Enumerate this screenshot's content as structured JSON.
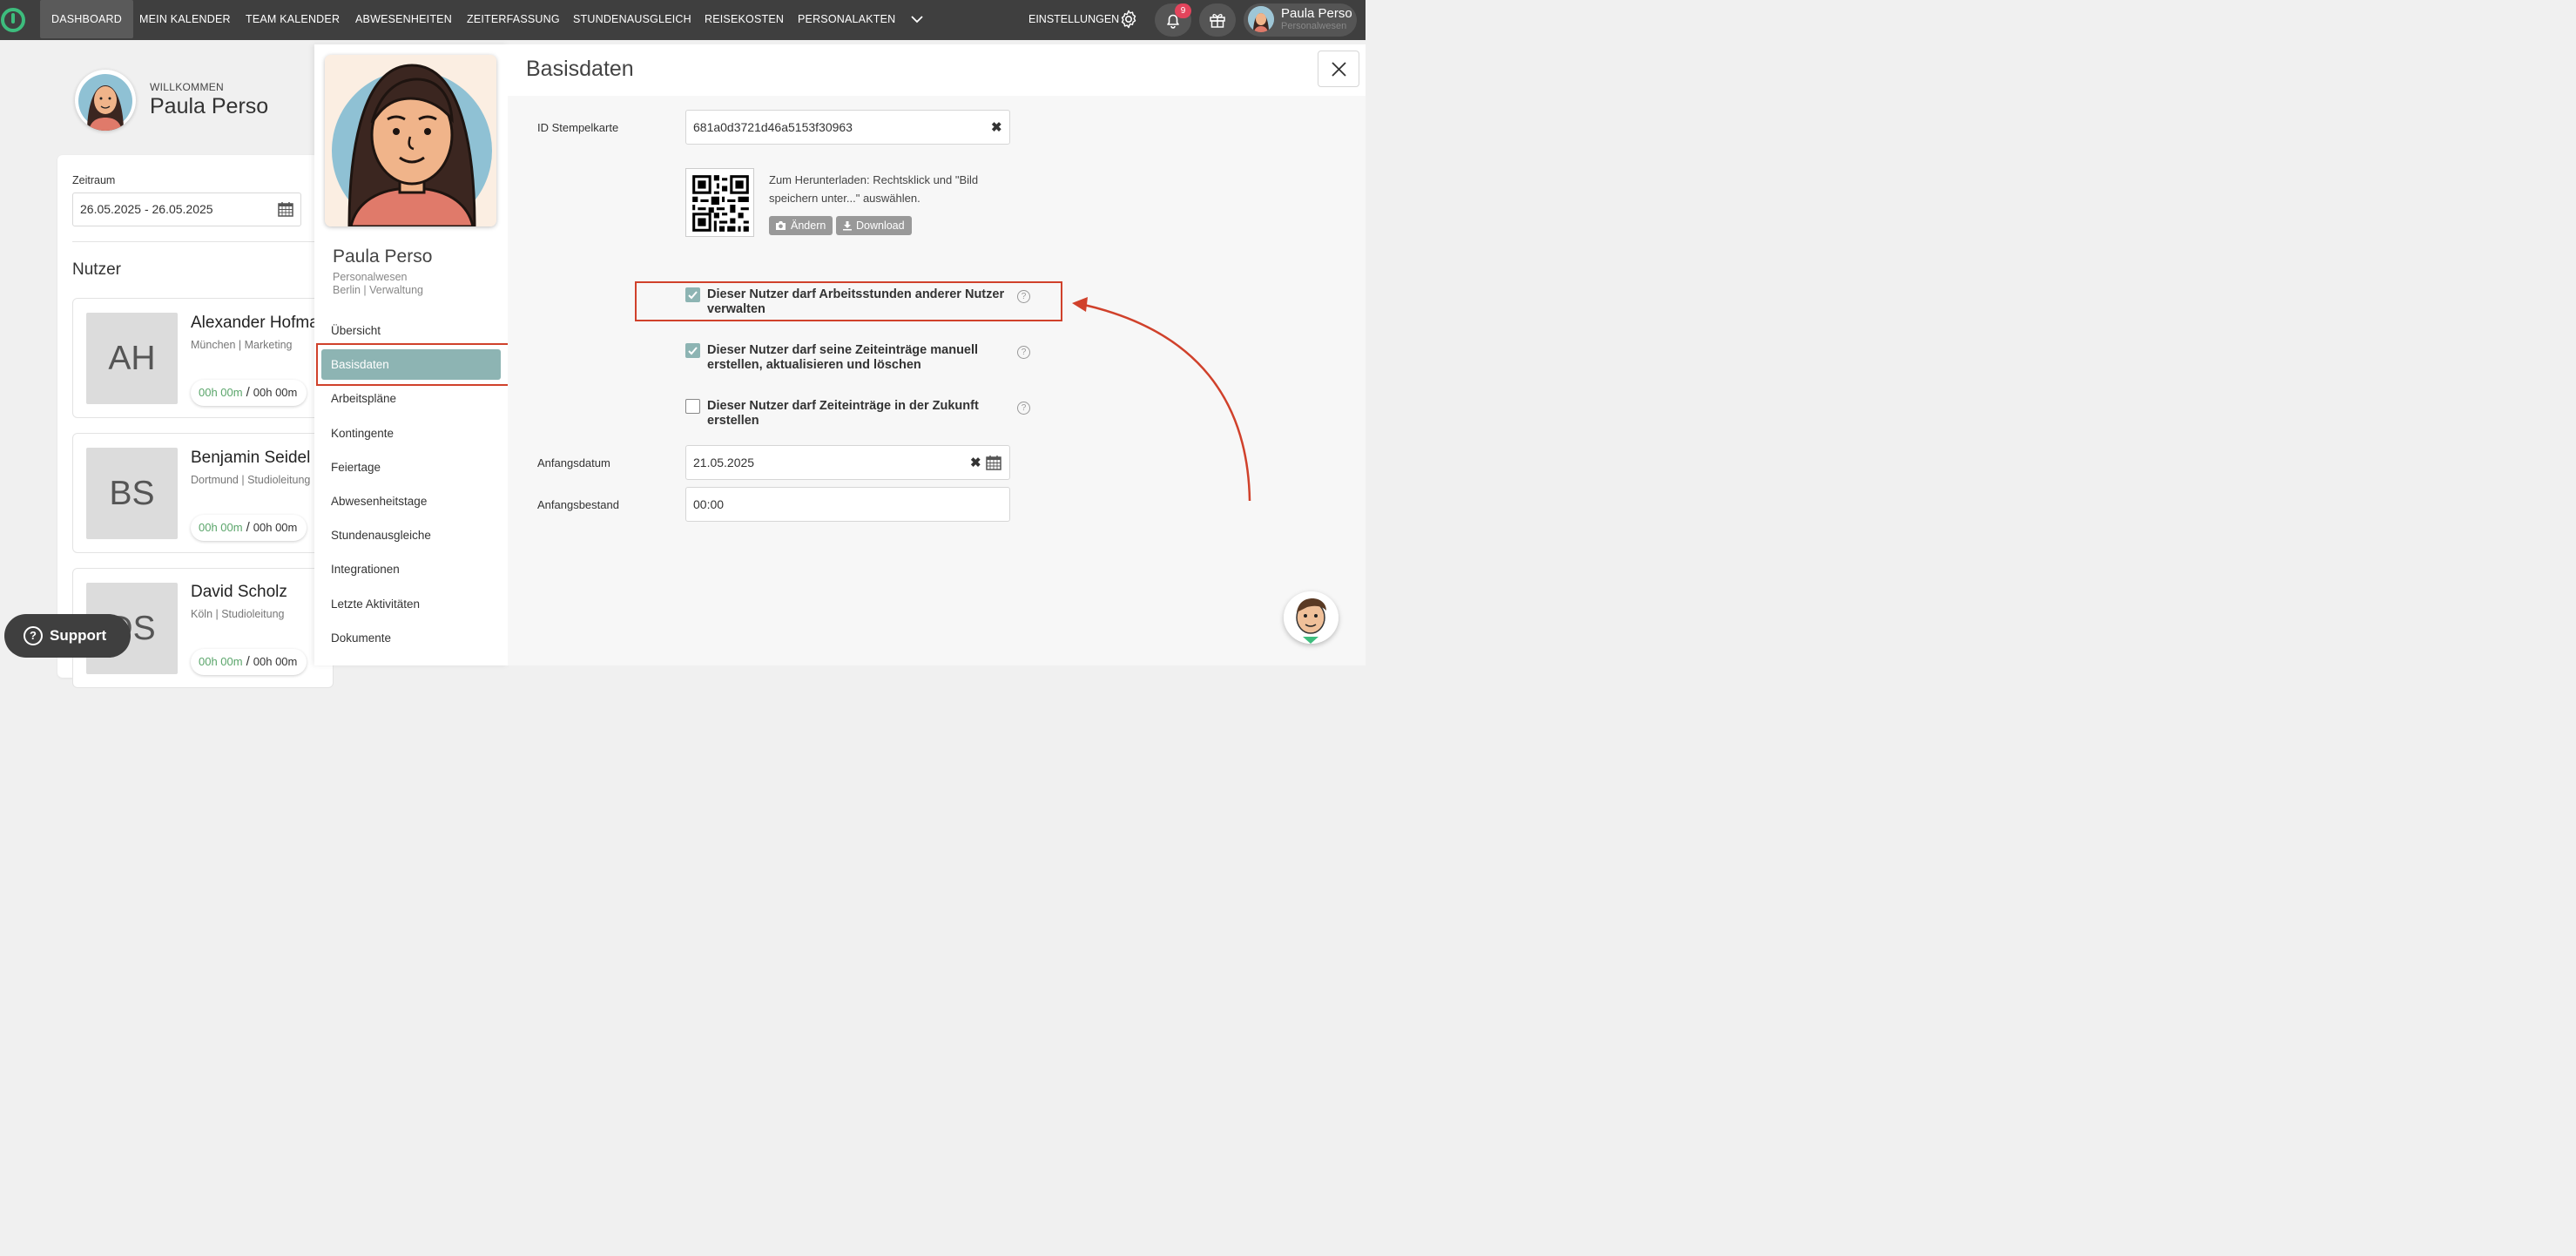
{
  "nav": {
    "items": [
      "DASHBOARD",
      "MEIN KALENDER",
      "TEAM KALENDER",
      "ABWESENHEITEN",
      "ZEITERFASSUNG",
      "STUNDENAUSGLEICH",
      "REISEKOSTEN",
      "PERSONALAKTEN"
    ],
    "active_index": 0,
    "settings_label": "EINSTELLUNGEN",
    "notification_count": "9",
    "user_name": "Paula Perso",
    "user_role": "Personalwesen"
  },
  "dashboard": {
    "welcome_label": "WILLKOMMEN",
    "welcome_name": "Paula Perso",
    "zeitraum_label": "Zeitraum",
    "zeitraum_value": "26.05.2025 - 26.05.2025",
    "nutzer_heading": "Nutzer",
    "users": [
      {
        "initials": "AH",
        "name": "Alexander Hofma",
        "location": "München | Marketing",
        "time_done": "00h 00m",
        "time_target": "00h 00m"
      },
      {
        "initials": "BS",
        "name": "Benjamin Seidel",
        "location": "Dortmund | Studioleitung",
        "time_done": "00h 00m",
        "time_target": "00h 00m"
      },
      {
        "initials": "DS",
        "name": "David Scholz",
        "location": "Köln | Studioleitung",
        "time_done": "00h 00m",
        "time_target": "00h 00m"
      }
    ]
  },
  "profile_panel": {
    "name": "Paula Perso",
    "role": "Personalwesen",
    "location": "Berlin | Verwaltung",
    "menu": [
      "Übersicht",
      "Basisdaten",
      "Arbeitspläne",
      "Kontingente",
      "Feiertage",
      "Abwesenheitstage",
      "Stundenausgleiche",
      "Integrationen",
      "Letzte Aktivitäten",
      "Dokumente"
    ],
    "active_menu": "Basisdaten"
  },
  "basisdaten": {
    "title": "Basisdaten",
    "stempelkarte_label": "ID Stempelkarte",
    "stempelkarte_value": "681a0d3721d46a5153f30963",
    "qr_hint": "Zum Herunterladen: Rechtsklick und \"Bild speichern unter...\" auswählen.",
    "change_button": "Ändern",
    "download_button": "Download",
    "permissions": [
      {
        "label": "Dieser Nutzer darf Arbeitsstunden anderer Nutzer verwalten",
        "checked": true
      },
      {
        "label": "Dieser Nutzer darf seine Zeiteinträge manuell erstellen, aktualisieren und löschen",
        "checked": true
      },
      {
        "label": "Dieser Nutzer darf Zeiteinträge in der Zukunft erstellen",
        "checked": false
      }
    ],
    "anfangsdatum_label": "Anfangsdatum",
    "anfangsdatum_value": "21.05.2025",
    "anfangsbestand_label": "Anfangsbestand",
    "anfangsbestand_value": "00:00"
  },
  "support": {
    "label": "Support"
  },
  "colors": {
    "accent": "#8db4b3",
    "highlight": "#d0412b",
    "brand": "#3dbd7d",
    "topbar": "#3f3f3f"
  }
}
